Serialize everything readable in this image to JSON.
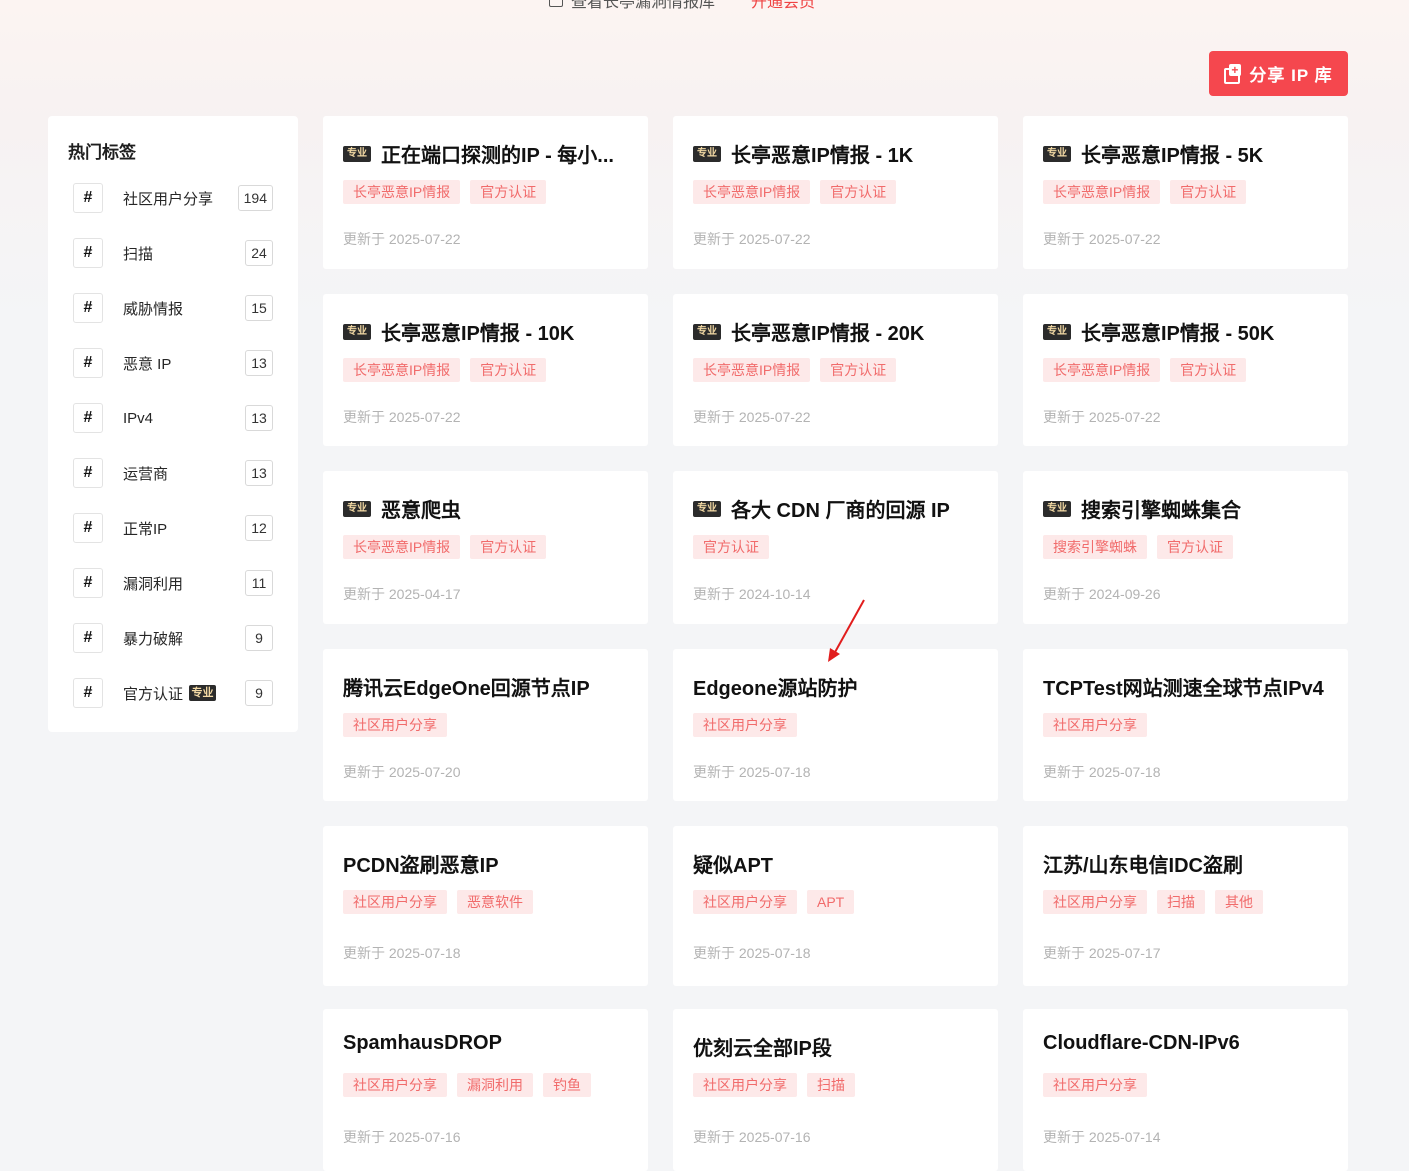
{
  "top": {
    "view_link": "查看长亭漏洞情报库",
    "vip_link": "开通会员"
  },
  "share_button": {
    "label": "分享 IP 库",
    "color": "#f5474e"
  },
  "sidebar": {
    "title": "热门标签",
    "items": [
      {
        "label": "社区用户分享",
        "count": "194",
        "pro": false
      },
      {
        "label": "扫描",
        "count": "24",
        "pro": false
      },
      {
        "label": "威胁情报",
        "count": "15",
        "pro": false
      },
      {
        "label": "恶意 IP",
        "count": "13",
        "pro": false
      },
      {
        "label": "IPv4",
        "count": "13",
        "pro": false
      },
      {
        "label": "运营商",
        "count": "13",
        "pro": false
      },
      {
        "label": "正常IP",
        "count": "12",
        "pro": false
      },
      {
        "label": "漏洞利用",
        "count": "11",
        "pro": false
      },
      {
        "label": "暴力破解",
        "count": "9",
        "pro": false
      },
      {
        "label": "官方认证",
        "count": "9",
        "pro": true
      }
    ]
  },
  "pro_badge": "专业",
  "cards": [
    {
      "title": "正在端口探测的IP - 每小...",
      "pro": true,
      "tags": [
        "长亭恶意IP情报",
        "官方认证"
      ],
      "date": "更新于 2025-07-22"
    },
    {
      "title": "长亭恶意IP情报 - 1K",
      "pro": true,
      "tags": [
        "长亭恶意IP情报",
        "官方认证"
      ],
      "date": "更新于 2025-07-22"
    },
    {
      "title": "长亭恶意IP情报 - 5K",
      "pro": true,
      "tags": [
        "长亭恶意IP情报",
        "官方认证"
      ],
      "date": "更新于 2025-07-22"
    },
    {
      "title": "长亭恶意IP情报 - 10K",
      "pro": true,
      "tags": [
        "长亭恶意IP情报",
        "官方认证"
      ],
      "date": "更新于 2025-07-22"
    },
    {
      "title": "长亭恶意IP情报 - 20K",
      "pro": true,
      "tags": [
        "长亭恶意IP情报",
        "官方认证"
      ],
      "date": "更新于 2025-07-22"
    },
    {
      "title": "长亭恶意IP情报 - 50K",
      "pro": true,
      "tags": [
        "长亭恶意IP情报",
        "官方认证"
      ],
      "date": "更新于 2025-07-22"
    },
    {
      "title": "恶意爬虫",
      "pro": true,
      "tags": [
        "长亭恶意IP情报",
        "官方认证"
      ],
      "date": "更新于 2025-04-17"
    },
    {
      "title": "各大 CDN 厂商的回源 IP",
      "pro": true,
      "tags": [
        "官方认证"
      ],
      "date": "更新于 2024-10-14"
    },
    {
      "title": "搜索引擎蜘蛛集合",
      "pro": true,
      "tags": [
        "搜索引擎蜘蛛",
        "官方认证"
      ],
      "date": "更新于 2024-09-26"
    },
    {
      "title": "腾讯云EdgeOne回源节点IP",
      "pro": false,
      "tags": [
        "社区用户分享"
      ],
      "date": "更新于 2025-07-20"
    },
    {
      "title": "Edgeone源站防护",
      "pro": false,
      "tags": [
        "社区用户分享"
      ],
      "date": "更新于 2025-07-18"
    },
    {
      "title": "TCPTest网站测速全球节点IPv4",
      "pro": false,
      "tags": [
        "社区用户分享"
      ],
      "date": "更新于 2025-07-18"
    },
    {
      "title": "PCDN盗刷恶意IP",
      "pro": false,
      "tags": [
        "社区用户分享",
        "恶意软件"
      ],
      "date": "更新于 2025-07-18"
    },
    {
      "title": "疑似APT",
      "pro": false,
      "tags": [
        "社区用户分享",
        "APT"
      ],
      "date": "更新于 2025-07-18"
    },
    {
      "title": "江苏/山东电信IDC盗刷",
      "pro": false,
      "tags": [
        "社区用户分享",
        "扫描",
        "其他"
      ],
      "date": "更新于 2025-07-17"
    },
    {
      "title": "SpamhausDROP",
      "pro": false,
      "tags": [
        "社区用户分享",
        "漏洞利用",
        "钓鱼"
      ],
      "date": "更新于 2025-07-16"
    },
    {
      "title": "优刻云全部IP段",
      "pro": false,
      "tags": [
        "社区用户分享",
        "扫描"
      ],
      "date": "更新于 2025-07-16"
    },
    {
      "title": "Cloudflare-CDN-IPv6",
      "pro": false,
      "tags": [
        "社区用户分享"
      ],
      "date": "更新于 2025-07-14"
    }
  ]
}
